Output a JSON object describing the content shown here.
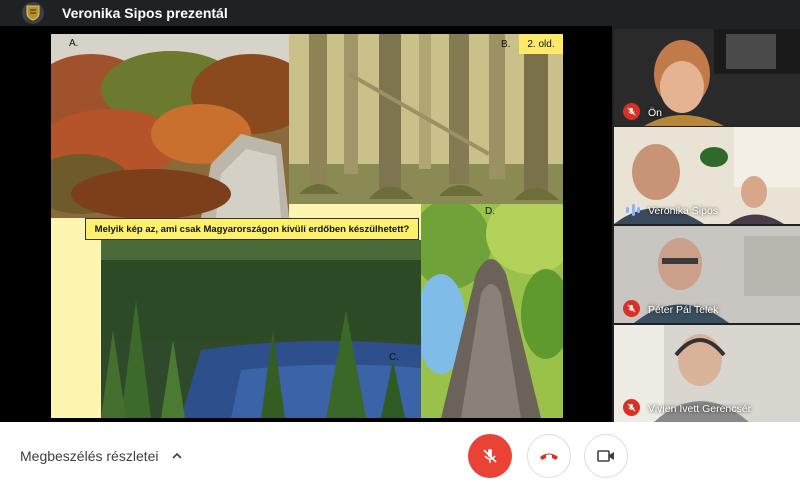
{
  "header": {
    "presenter_text": "Veronika Sipos prezentál",
    "logo_icon": "school-crest-icon"
  },
  "slide": {
    "page_badge": "2. old.",
    "question": "Melyik kép az, ami csak Magyarországon kívüli erdőben készülhetett?",
    "photo_labels": {
      "a": "A.",
      "b": "B.",
      "c": "C.",
      "d": "D."
    }
  },
  "participants": [
    {
      "name": "Ön",
      "status": "muted"
    },
    {
      "name": "Veronika Sipos",
      "status": "speaking"
    },
    {
      "name": "Péter Pál Telek",
      "status": "muted"
    },
    {
      "name": "Vivien Ivett Gerencsér",
      "status": "muted"
    }
  ],
  "controls": {
    "details_label": "Megbeszélés részletei",
    "mic_icon": "mic-off-icon",
    "hangup_icon": "hang-up-icon",
    "camera_icon": "camera-icon"
  },
  "colors": {
    "mute_red": "#d93025",
    "mic_button_red": "#ea4335",
    "hangup_red": "#d93025",
    "speaking_blue": "#8ab4f8",
    "slide_yellow": "#fdf16c"
  }
}
